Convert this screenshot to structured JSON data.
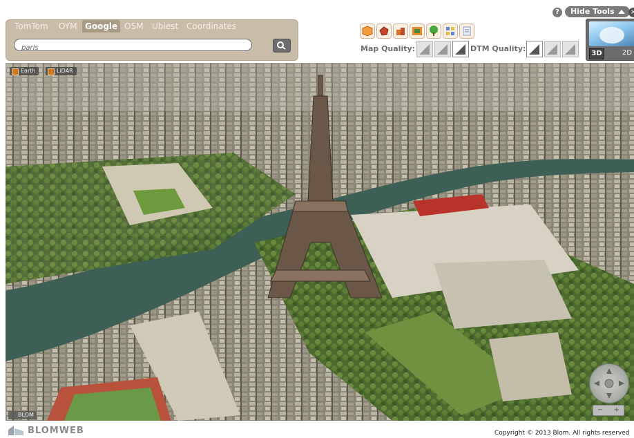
{
  "top": {
    "help_glyph": "?",
    "hide_tools_label": "Hide Tools",
    "close_glyph": "×"
  },
  "tabs": [
    {
      "label": "TomTom",
      "active": false
    },
    {
      "label": "OYM",
      "active": false
    },
    {
      "label": "Google",
      "active": true
    },
    {
      "label": "OSM",
      "active": false
    },
    {
      "label": "Ubiest",
      "active": false
    },
    {
      "label": "Coordinates",
      "active": false
    }
  ],
  "search": {
    "value": "paris",
    "button_icon": "magnifier-icon"
  },
  "layers_toolbar": {
    "icons": [
      "box-3d-icon",
      "shape-icon",
      "buildings-icon",
      "photo-icon",
      "tree-icon",
      "grid-icon",
      "list-icon"
    ]
  },
  "quality": {
    "map_label": "Map Quality:",
    "dtm_label": "DTM Quality:",
    "map_levels_selected": 2,
    "dtm_levels_selected": 0
  },
  "view_mode": {
    "label_3d": "3D",
    "label_2d": "2D",
    "selected": "3D"
  },
  "map": {
    "layer_chips": [
      "Earth",
      "LiDAR"
    ],
    "blom_watermark": "BLOM",
    "zoom_minus": "−",
    "zoom_plus": "+"
  },
  "footer": {
    "logo_text": "BLOMWEB",
    "copyright": "Copyright © 2013 Blom. All rights reserved"
  },
  "colors": {
    "panel": "#c9bca9",
    "tab_active": "#a99c86",
    "river": "#3e5f56",
    "grass": "#5a7a3a"
  }
}
